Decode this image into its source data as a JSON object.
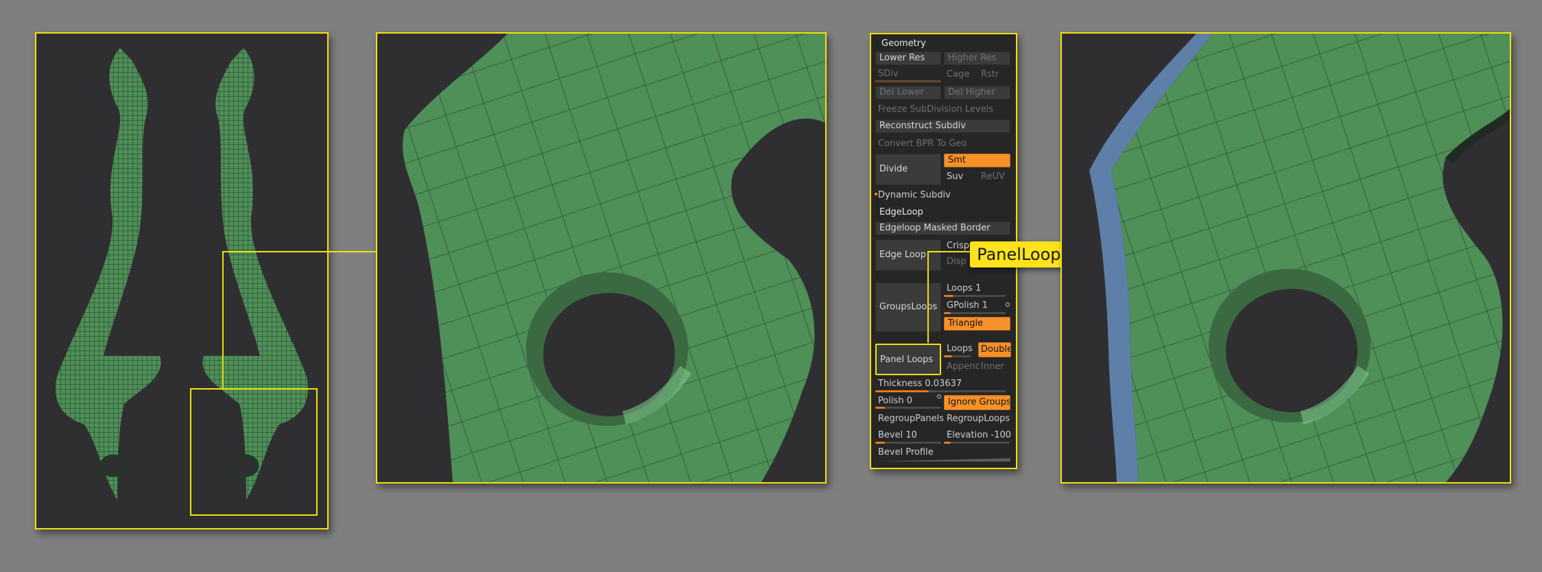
{
  "panel": {
    "title": "Geometry",
    "lower_res": "Lower Res",
    "higher_res": "Higher Res",
    "sdiv": "SDiv",
    "cage": "Cage",
    "rstr": "Rstr",
    "del_lower": "Del Lower",
    "del_higher": "Del Higher",
    "freeze": "Freeze SubDivision Levels",
    "reconstruct": "Reconstruct Subdiv",
    "convert_bpr": "Convert BPR To Geo",
    "divide": "Divide",
    "smt": "Smt",
    "suv": "Suv",
    "reuv": "ReUV",
    "dynamic_subdiv": "Dynamic Subdiv",
    "edgeloop_header": "EdgeLoop",
    "edgeloop_masked": "Edgeloop Masked Border",
    "edge_loop": "Edge Loop",
    "crisp": "Crisp",
    "disp": "Disp",
    "groups_loops": "GroupsLoops",
    "loops_1": "Loops 1",
    "gpolish_1": "GPolish 1",
    "triangle": "Triangle",
    "panel_loops": "Panel Loops",
    "loops": "Loops",
    "double": "Double",
    "append": "Appenc",
    "inner": "Inner",
    "thickness": "Thickness 0.03637",
    "polish": "Polish 0",
    "ignore_groups": "Ignore Groups",
    "regroup_panels": "RegroupPanels",
    "regroup_loops": "RegroupLoops",
    "bevel": "Bevel 10",
    "elevation": "Elevation -100",
    "bevel_profile": "Bevel Profile"
  },
  "callout": {
    "text": "PanelLoops 적용"
  },
  "colors": {
    "highlight": "#f2e20c",
    "active_button": "#f6912a",
    "mesh_green": "#4f8f58",
    "panel_bg": "#262626"
  }
}
